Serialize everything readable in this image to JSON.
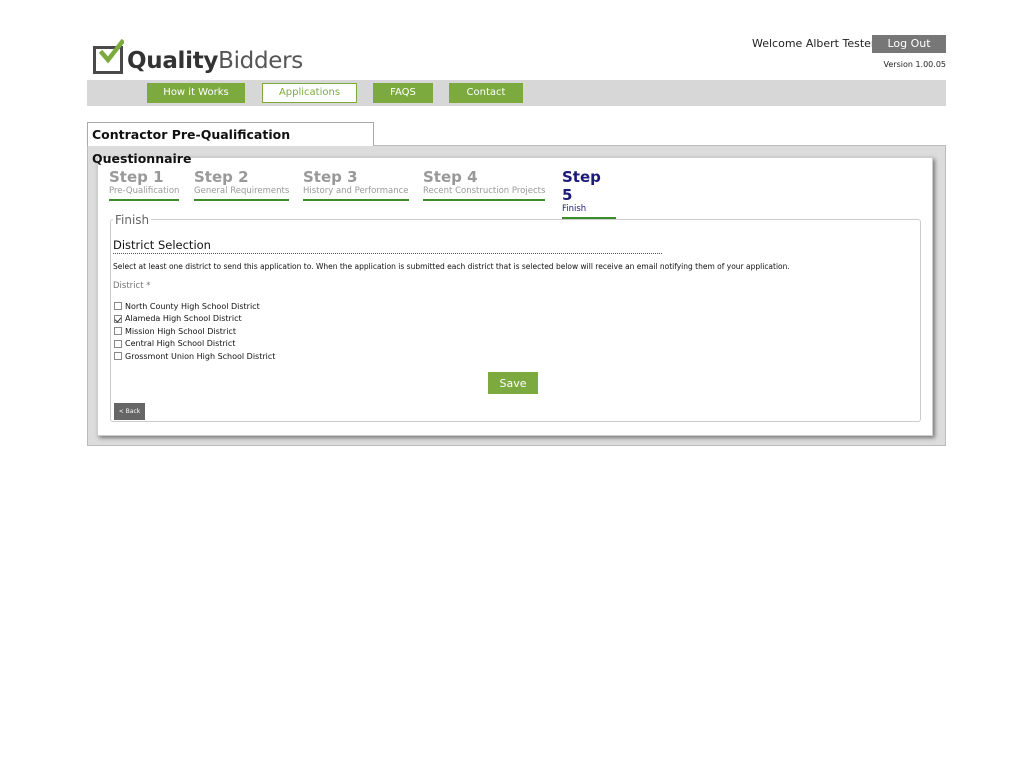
{
  "header": {
    "logo": {
      "bold": "Quality",
      "light": "Bidders",
      "icon": "check-box-icon"
    },
    "welcome": "Welcome Albert Tester",
    "logout_label": "Log Out",
    "version": "Version 1.00.05"
  },
  "nav": {
    "items": [
      {
        "label": "How it Works",
        "active": false
      },
      {
        "label": "Applications",
        "active": true
      },
      {
        "label": "FAQS",
        "active": false
      },
      {
        "label": "Contact",
        "active": false
      }
    ]
  },
  "page": {
    "tab_title": "Contractor Pre-Qualification Questionnaire"
  },
  "steps": [
    {
      "title": "Step 1",
      "subtitle": "Pre-Qualification",
      "current": false
    },
    {
      "title": "Step 2",
      "subtitle": "General Requirements",
      "current": false
    },
    {
      "title": "Step 3",
      "subtitle": "History and Performance",
      "current": false
    },
    {
      "title": "Step 4",
      "subtitle": "Recent Construction Projects",
      "current": false
    },
    {
      "title": "Step 5",
      "subtitle": "Finish",
      "current": true
    }
  ],
  "form": {
    "legend": "Finish",
    "section_title": "District Selection",
    "instructions": "Select at least one district to send this application to. When the application is submitted each district that is selected below will receive an email notifying them of your application.",
    "district_label": "District *",
    "districts": [
      {
        "label": "North County High School District",
        "checked": false
      },
      {
        "label": "Alameda High School District",
        "checked": true
      },
      {
        "label": "Mission High School District",
        "checked": false
      },
      {
        "label": "Central High School District",
        "checked": false
      },
      {
        "label": "Grossmont Union High School District",
        "checked": false
      }
    ],
    "save_label": "Save",
    "back_label": "< Back"
  },
  "colors": {
    "accent_green": "#7daa3f",
    "step_underline": "#3c8c2a",
    "current_step": "#1c1a7a",
    "logout_bg": "#777777"
  }
}
